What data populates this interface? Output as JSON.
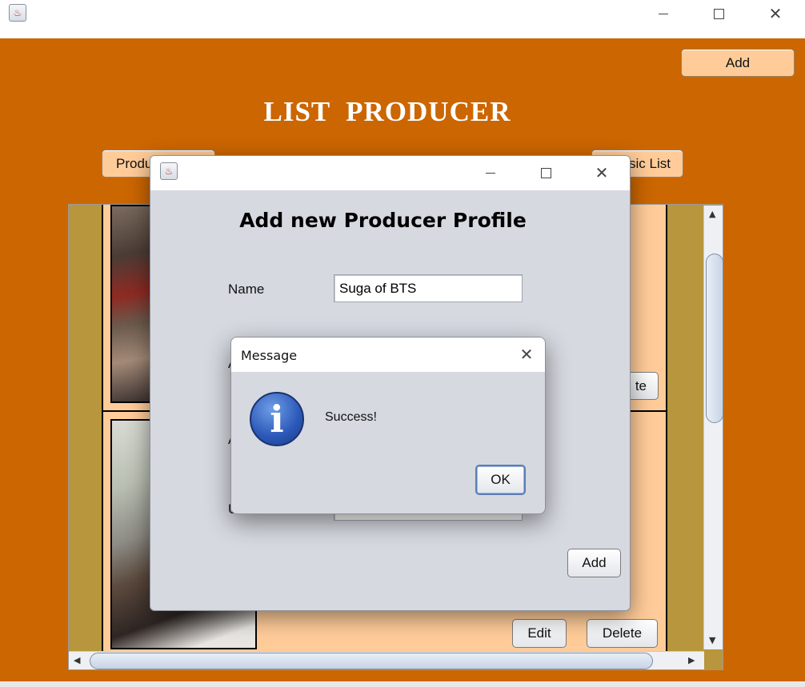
{
  "main_window": {
    "titlebar": {
      "app_icon": "java-coffee-icon"
    },
    "add_button_label": "Add",
    "heading": "LIST  PRODUCER",
    "nav_buttons": {
      "left_label": "Produ",
      "right_label": "sic List"
    },
    "cards": [
      {
        "delete_label_partial": "te"
      },
      {
        "edit_label": "Edit",
        "delete_label": "Delete"
      }
    ]
  },
  "dialog": {
    "heading": "Add new Producer Profile",
    "name_label": "Name",
    "name_value": "Suga of BTS",
    "hidden_label_1": "A",
    "hidden_label_2": "A",
    "hidden_label_3": "U",
    "add_button_label": "Add"
  },
  "message_box": {
    "title": "Message",
    "text": "Success!",
    "ok_label": "OK",
    "icon": "info-icon"
  },
  "colors": {
    "content_background": "#cc6600",
    "card_background": "#ffcc99",
    "list_background": "#b8963e",
    "dialog_background": "#d6d9e0"
  }
}
